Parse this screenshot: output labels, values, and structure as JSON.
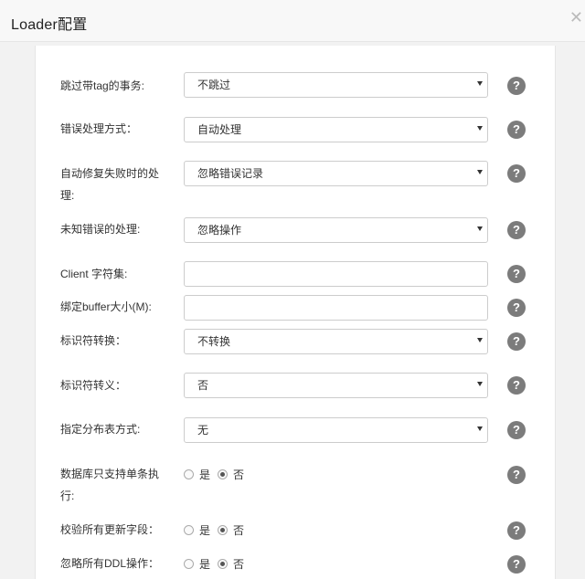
{
  "dialog": {
    "title": "Loader配置",
    "close_glyph": "✕"
  },
  "help_glyph": "?",
  "fields": {
    "skip_tag": {
      "label": "跳过带tag的事务:",
      "value": "不跳过"
    },
    "error_mode": {
      "label": "错误处理方式：",
      "value": "自动处理"
    },
    "auto_repair": {
      "label_line1": "自动修复失败时的处",
      "label_line2": "理:",
      "value": "忽略错误记录"
    },
    "unknown_error": {
      "label": "未知错误的处理:",
      "value": "忽略操作"
    },
    "client_charset": {
      "label": "Client 字符集:",
      "value": ""
    },
    "bind_buffer": {
      "label": "绑定buffer大小(M):",
      "value": ""
    },
    "identifier_convert": {
      "label": "标识符转换：",
      "value": "不转换"
    },
    "identifier_escape": {
      "label": "标识符转义：",
      "value": "否"
    },
    "dist_table_mode": {
      "label": "指定分布表方式:",
      "value": "无"
    },
    "single_exec": {
      "label_line1": "数据库只支持单条执",
      "label_line2": "行:",
      "yes": "是",
      "no": "否",
      "selected": "否"
    },
    "check_update_fields": {
      "label": "校验所有更新字段：",
      "yes": "是",
      "no": "否",
      "selected": "否"
    },
    "ignore_ddl": {
      "label": "忽略所有DDL操作：",
      "yes": "是",
      "no": "否",
      "selected": "否"
    }
  }
}
